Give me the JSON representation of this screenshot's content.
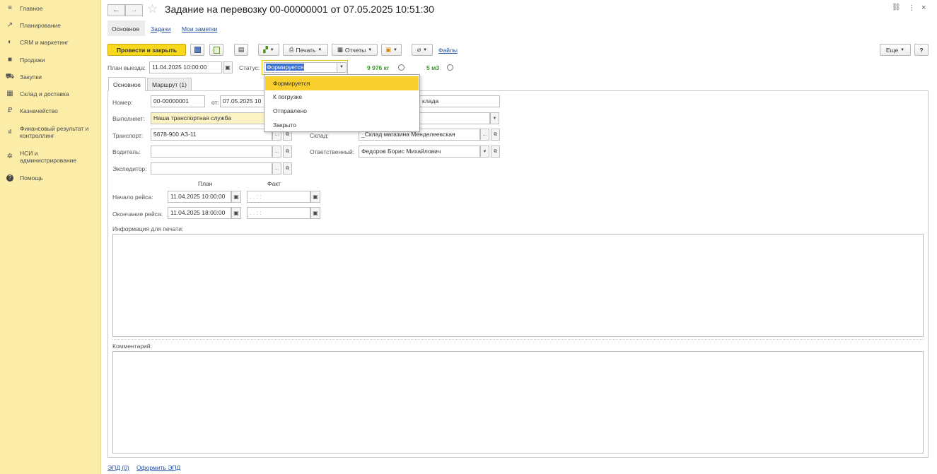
{
  "sidebar": {
    "items": [
      {
        "label": "Главное",
        "icon": "menu-icon",
        "glyph": "≡"
      },
      {
        "label": "Планирование",
        "icon": "planning-icon",
        "glyph": "↗"
      },
      {
        "label": "CRM и маркетинг",
        "icon": "crm-icon",
        "glyph": "◐"
      },
      {
        "label": "Продажи",
        "icon": "sales-bag-icon",
        "glyph": "■"
      },
      {
        "label": "Закупки",
        "icon": "cart-icon",
        "glyph": "⛟"
      },
      {
        "label": "Склад и доставка",
        "icon": "warehouse-icon",
        "glyph": "▦"
      },
      {
        "label": "Казначейство",
        "icon": "treasury-icon",
        "glyph": "₽"
      },
      {
        "label": "Финансовый результат и контроллинг",
        "icon": "finance-chart-icon",
        "glyph": "ıl"
      },
      {
        "label": "НСИ и администрирование",
        "icon": "settings-gear-icon",
        "glyph": "✲"
      },
      {
        "label": "Помощь",
        "icon": "help-icon",
        "glyph": "?"
      }
    ]
  },
  "header": {
    "back": "←",
    "forward": "→",
    "star": "☆",
    "title": "Задание на перевозку 00-00000001 от 07.05.2025 10:51:30",
    "link_icon": "🔗",
    "more_icon": "⋮",
    "close_icon": "×"
  },
  "top_tabs": {
    "main": "Основное",
    "tasks": "Задачи",
    "notes": "Мои заметки"
  },
  "toolbar": {
    "post_close": "Провести и закрыть",
    "print": "Печать",
    "reports": "Отчеты",
    "files": "Файлы",
    "more": "Еще",
    "help": "?"
  },
  "plan_row": {
    "plan_label": "План выезда:",
    "plan_value": "11.04.2025 10:00:00",
    "status_label": "Статус:",
    "status_value": "Формируется",
    "weight": "9 976 кг",
    "volume": "5 м3"
  },
  "form_tabs": {
    "main": "Основное",
    "route": "Маршрут (1)"
  },
  "form": {
    "number_label": "Номер:",
    "number_value": "00-00000001",
    "from_label": "от:",
    "from_value": "07.05.2025 10",
    "dest_value": "клада",
    "executor_label": "Выполняет:",
    "executor_value": "Наша транспортная служба",
    "transport_label": "Транспорт:",
    "transport_value": "5678-900 АЗ-11",
    "warehouse_label": "Склад:",
    "warehouse_value": "_Склад магазина Менделеевская",
    "driver_label": "Водитель:",
    "responsible_label": "Ответственный:",
    "responsible_value": "Федоров Борис Михайлович",
    "forwarder_label": "Экспедитор:",
    "plan_header": "План",
    "fact_header": "Факт",
    "trip_start_label": "Начало рейса:",
    "trip_start_plan": "11.04.2025 10:00:00",
    "trip_end_label": "Окончание рейса:",
    "trip_end_plan": "11.04.2025 18:00:00",
    "fact_placeholder": " .  .      :  :",
    "print_info_label": "Информация для печати:",
    "comment_label": "Комментарий:"
  },
  "status_dropdown": {
    "options": [
      "Формируется",
      "К погрузке",
      "Отправлено",
      "Закрыто"
    ],
    "selected": "Формируется"
  },
  "footer": {
    "epd": "ЭПД (0)",
    "make_epd": "Оформить ЭПД"
  },
  "colors": {
    "sidebar": "#fbeca8",
    "primary_button": "#f8d81c",
    "accent_green": "#3a9a2a",
    "link": "#1f4ea3",
    "selected_option": "#f9cf2d"
  }
}
